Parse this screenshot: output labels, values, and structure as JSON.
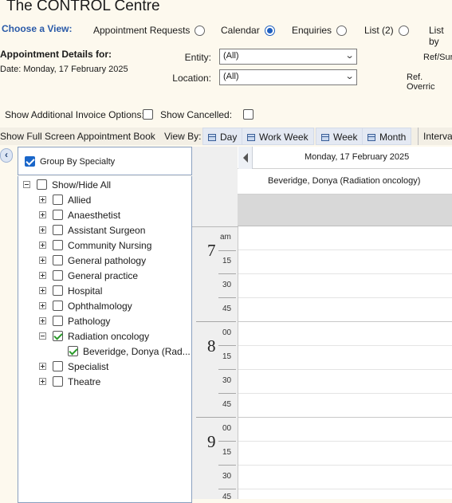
{
  "app": {
    "title": "The CONTROL Centre"
  },
  "view_chooser": {
    "label": "Choose a View:",
    "options": [
      {
        "label": "Appointment Requests",
        "selected": false
      },
      {
        "label": "Calendar",
        "selected": true
      },
      {
        "label": "Enquiries",
        "selected": false
      },
      {
        "label": "List (2)",
        "selected": false
      },
      {
        "label": "List by",
        "selected": false
      }
    ]
  },
  "details": {
    "heading": "Appointment Details for:",
    "date": "Date: Monday, 17 February 2025",
    "entity_label": "Entity:",
    "entity_value": "(All)",
    "location_label": "Location:",
    "location_value": "(All)",
    "ref_sur_label": "Ref/Sur",
    "ref_override_label": "Ref. Overric"
  },
  "options": {
    "additional_invoice_label": "Show Additional Invoice Options:",
    "additional_invoice_checked": false,
    "show_cancelled_label": "Show Cancelled:",
    "show_cancelled_checked": false
  },
  "toolbar": {
    "full_screen": "Show Full Screen Appointment Book",
    "view_by": "View By:",
    "day": "Day",
    "work_week": "Work Week",
    "week": "Week",
    "month": "Month",
    "interval": "Interva"
  },
  "left_panel": {
    "collapse_glyph": "‹",
    "group_by_label": "Group By Specialty",
    "group_by_checked": true,
    "show_hide_label": "Show/Hide All",
    "specialties": [
      {
        "label": "Allied",
        "checked": false
      },
      {
        "label": "Anaesthetist",
        "checked": false
      },
      {
        "label": "Assistant Surgeon",
        "checked": false
      },
      {
        "label": "Community Nursing",
        "checked": false
      },
      {
        "label": "General pathology",
        "checked": false
      },
      {
        "label": "General practice",
        "checked": false
      },
      {
        "label": "Hospital",
        "checked": false
      },
      {
        "label": "Ophthalmology",
        "checked": false
      },
      {
        "label": "Pathology",
        "checked": false
      },
      {
        "label": "Radiation oncology",
        "checked": true,
        "expanded": true
      },
      {
        "label": "Specialist",
        "checked": false
      },
      {
        "label": "Theatre",
        "checked": false
      }
    ],
    "child_item": {
      "label": "Beveridge,  Donya  (Rad...",
      "checked": true
    }
  },
  "calendar": {
    "date_header": "Monday, 17 February 2025",
    "resource": "Beveridge, Donya (Radiation oncology)",
    "ampm": "am",
    "hours": [
      {
        "hour": "7",
        "minutes": [
          "",
          "15",
          "30",
          "45"
        ]
      },
      {
        "hour": "8",
        "minutes": [
          "00",
          "15",
          "30",
          "45"
        ]
      },
      {
        "hour": "9",
        "minutes": [
          "00",
          "15",
          "30",
          "45"
        ]
      }
    ]
  }
}
